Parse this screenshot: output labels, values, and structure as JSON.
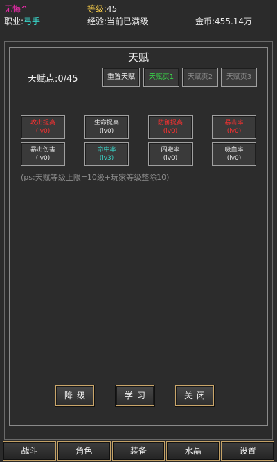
{
  "header": {
    "name": "无悔^",
    "level_label": "等级:",
    "level_value": "45",
    "class_label": "职业:",
    "class_value": "弓手",
    "exp_text": "经验:当前已满级",
    "gold_text": "金币:455.14万"
  },
  "panel": {
    "title": "天赋",
    "points": "天赋点:0/45",
    "buttons": {
      "reset": "重置天赋",
      "page1": "天赋页1",
      "page2": "天赋页2",
      "page3": "天赋页3"
    },
    "talents": [
      {
        "name": "攻击提高",
        "level": "(lv0)",
        "color": "#ff3030"
      },
      {
        "name": "生命提高",
        "level": "(lv0)",
        "color": "#e6e6e6"
      },
      {
        "name": "防御提高",
        "level": "(lv0)",
        "color": "#ff3030"
      },
      {
        "name": "暴击率",
        "level": "(lv0)",
        "color": "#ff3030"
      },
      {
        "name": "暴击伤害",
        "level": "(lv0)",
        "color": "#e6e6e6"
      },
      {
        "name": "命中率",
        "level": "(lv3)",
        "color": "#39d4c8"
      },
      {
        "name": "闪避率",
        "level": "(lv0)",
        "color": "#e6e6e6"
      },
      {
        "name": "吸血率",
        "level": "(lv0)",
        "color": "#e6e6e6"
      }
    ],
    "note": "(ps:天赋等级上限=10级+玩家等级整除10)"
  },
  "actions": {
    "downgrade": "降级",
    "learn": "学习",
    "close": "关闭"
  },
  "nav": [
    "战斗",
    "角色",
    "装备",
    "水晶",
    "设置"
  ],
  "colors": {
    "background": "#2b2b2b",
    "active_page": "#39e14a",
    "inactive_page": "#8a8a8a",
    "gold_border": "#c4a267"
  }
}
